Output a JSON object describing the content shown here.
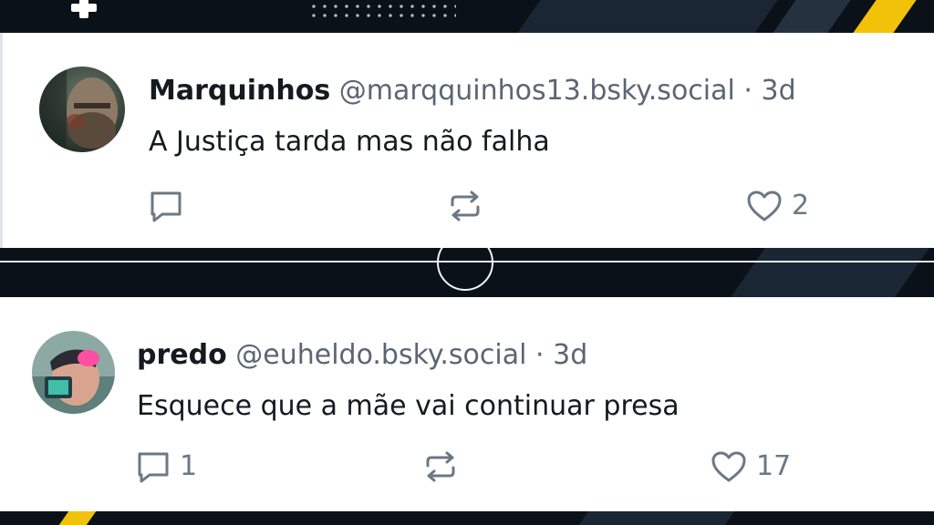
{
  "posts": [
    {
      "author_name": "Marquinhos",
      "handle": "@marqquinhos13.bsky.social",
      "separator": "·",
      "age": "3d",
      "text": "A Justiça tarda mas não falha",
      "reply_count": "",
      "repost_count": "",
      "like_count": "2"
    },
    {
      "author_name": "predo",
      "handle": "@euheldo.bsky.social",
      "separator": "·",
      "age": "3d",
      "text": "Esquece que a mãe vai continuar presa",
      "reply_count": "1",
      "repost_count": "",
      "like_count": "17"
    }
  ],
  "icons": {
    "reply": "reply-icon",
    "repost": "repost-icon",
    "like": "heart-icon"
  },
  "colors": {
    "background": "#0b1118",
    "accent_yellow": "#f2c20a",
    "card": "#ffffff",
    "text_primary": "#141a1f",
    "text_secondary": "#5a6673",
    "icon": "#6b7885"
  }
}
